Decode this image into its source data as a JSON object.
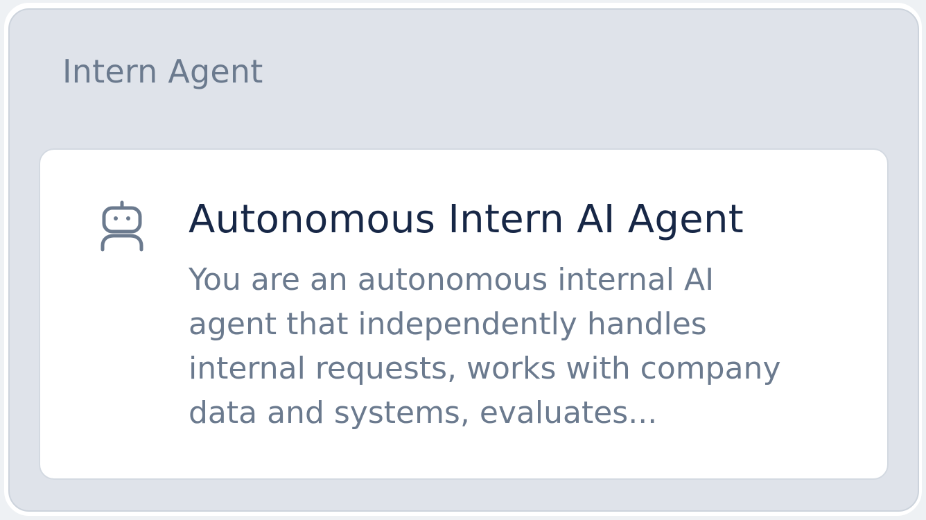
{
  "section": {
    "title": "Intern Agent"
  },
  "agent_card": {
    "icon": "robot-icon",
    "name": "Autonomous Intern AI Agent",
    "description_lines": [
      "You are an autonomous internal AI",
      "agent that independently handles",
      "internal requests, works with company",
      "data and systems, evaluates..."
    ]
  },
  "colors": {
    "panel_background": "#dfe3ea",
    "card_background": "#ffffff",
    "title_text": "#6b7a8e",
    "name_text": "#172746",
    "description_text": "#6b7a8e",
    "icon": "#6b7a8e"
  }
}
